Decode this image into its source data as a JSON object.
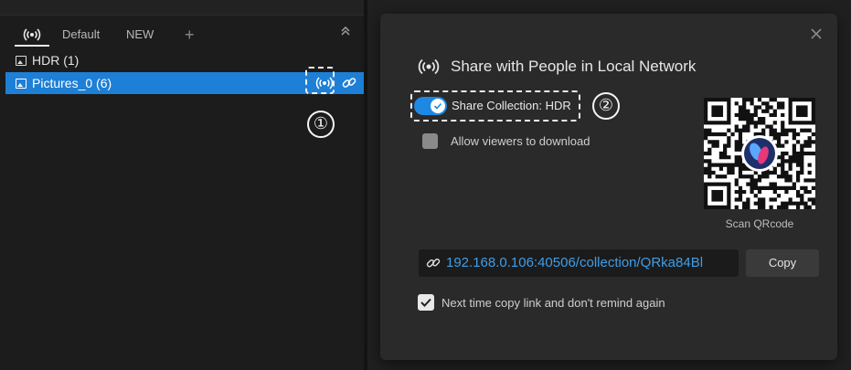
{
  "sidebar": {
    "tabs": [
      {
        "label": "",
        "icon": "broadcast-icon",
        "active": true
      },
      {
        "label": "Default"
      },
      {
        "label": "NEW"
      }
    ],
    "add_tab_icon": "plus-icon",
    "collapse_icon": "chevron-double-up-icon",
    "items": [
      {
        "label": "HDR (1)",
        "icon": "image-icon",
        "selected": false
      },
      {
        "label": "Pictures_0 (6)",
        "icon": "image-icon",
        "selected": true
      }
    ],
    "selected_color": "#1e7fd6"
  },
  "annotations": {
    "step1": "①",
    "step2": "②"
  },
  "dialog": {
    "title": "Share with People in Local Network",
    "title_icon": "broadcast-icon",
    "share_toggle": {
      "label": "Share Collection: HDR",
      "on": true
    },
    "allow_download": {
      "label": "Allow viewers to download",
      "checked": false
    },
    "qr_caption": "Scan QRcode",
    "url": "192.168.0.106:40506/collection/QRka84Bl",
    "copy_label": "Copy",
    "remember": {
      "label": "Next time copy link and don't remind again",
      "checked": true
    },
    "accent_color": "#1e88e5",
    "link_color": "#3f9ee8"
  }
}
